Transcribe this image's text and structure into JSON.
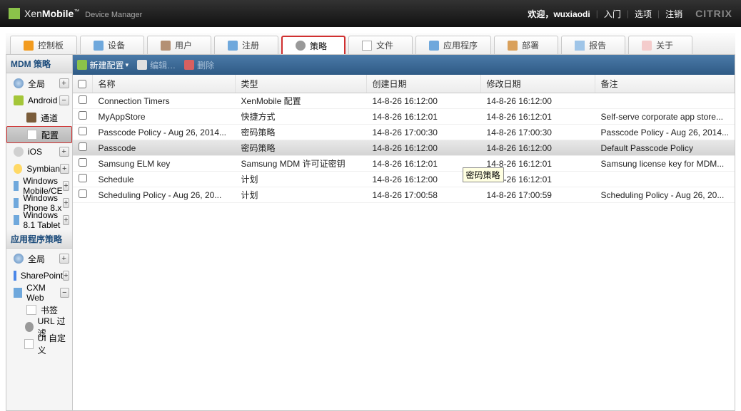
{
  "header": {
    "brand_main": "Xen",
    "brand_bold": "Mobile",
    "brand_sub": "Device Manager",
    "welcome": "欢迎，wuxiaodi",
    "links": [
      "入门",
      "选项",
      "注销"
    ],
    "citrix": "CITRIX"
  },
  "tabs": [
    {
      "label": "控制板",
      "icon": "ico-dashboard"
    },
    {
      "label": "设备",
      "icon": "ico-device"
    },
    {
      "label": "用户",
      "icon": "ico-user"
    },
    {
      "label": "注册",
      "icon": "ico-reg"
    },
    {
      "label": "策略",
      "icon": "ico-policy",
      "active": true
    },
    {
      "label": "文件",
      "icon": "ico-file"
    },
    {
      "label": "应用程序",
      "icon": "ico-app"
    },
    {
      "label": "部署",
      "icon": "ico-deploy"
    },
    {
      "label": "报告",
      "icon": "ico-report"
    },
    {
      "label": "关于",
      "icon": "ico-about"
    }
  ],
  "side": {
    "panel1": "MDM 策略",
    "panel2": "应用程序策略",
    "tree1": [
      {
        "label": "全局",
        "icon": "t-globe",
        "btn": "+",
        "pad": 0
      },
      {
        "label": "Android",
        "icon": "t-android",
        "btn": "−",
        "pad": 0
      },
      {
        "label": "通道",
        "icon": "t-channel",
        "pad": 1
      },
      {
        "label": "配置",
        "icon": "t-config",
        "pad": 1,
        "selected": true,
        "hl": true
      },
      {
        "label": "iOS",
        "icon": "t-ios",
        "btn": "+",
        "pad": 0
      },
      {
        "label": "Symbian",
        "icon": "t-symbian",
        "btn": "+",
        "pad": 0
      },
      {
        "label": "Windows Mobile/CE",
        "icon": "t-wm",
        "btn": "+",
        "pad": 0
      },
      {
        "label": "Windows Phone 8.x",
        "icon": "t-wm",
        "btn": "+",
        "pad": 0
      },
      {
        "label": "Windows 8.1 Tablet",
        "icon": "t-wm",
        "btn": "+",
        "pad": 0
      }
    ],
    "tree2": [
      {
        "label": "全局",
        "icon": "t-globe",
        "btn": "+",
        "pad": 0
      },
      {
        "label": "SharePoint",
        "icon": "t-sp",
        "btn": "+",
        "pad": 0
      },
      {
        "label": "CXM Web",
        "icon": "t-cxm",
        "btn": "−",
        "pad": 0
      },
      {
        "label": "书签",
        "icon": "t-config",
        "pad": 1
      },
      {
        "label": "URL 过滤",
        "icon": "t-filter",
        "pad": 1
      },
      {
        "label": "UI 自定义",
        "icon": "t-config",
        "pad": 1
      }
    ]
  },
  "toolbar": {
    "new": "新建配置",
    "edit": "编辑…",
    "del": "删除"
  },
  "tooltip": "密码策略",
  "table": {
    "headers": [
      "名称",
      "类型",
      "创建日期",
      "修改日期",
      "备注"
    ],
    "rows": [
      {
        "name": "Connection Timers",
        "type": "XenMobile 配置",
        "created": "14-8-26 16:12:00",
        "modified": "14-8-26 16:12:00",
        "note": ""
      },
      {
        "name": "MyAppStore",
        "type": "快捷方式",
        "created": "14-8-26 16:12:01",
        "modified": "14-8-26 16:12:01",
        "note": "Self-serve corporate app store..."
      },
      {
        "name": "Passcode Policy - Aug 26, 2014...",
        "type": "密码策略",
        "created": "14-8-26 17:00:30",
        "modified": "14-8-26 17:00:30",
        "note": "Passcode Policy - Aug 26, 2014..."
      },
      {
        "name": "Passcode",
        "type": "密码策略",
        "created": "14-8-26 16:12:00",
        "modified": "14-8-26 16:12:00",
        "note": "Default Passcode Policy",
        "sel": true
      },
      {
        "name": "Samsung ELM key",
        "type": "Samsung MDM 许可证密钥",
        "created": "14-8-26 16:12:01",
        "modified": "14-8-26 16:12:01",
        "note": "Samsung license key for MDM...",
        "tooltip": true
      },
      {
        "name": "Schedule",
        "type": "计划",
        "created": "14-8-26 16:12:00",
        "modified": "14-8-26 16:12:01",
        "note": ""
      },
      {
        "name": "Scheduling Policy - Aug 26, 20...",
        "type": "计划",
        "created": "14-8-26 17:00:58",
        "modified": "14-8-26 17:00:59",
        "note": "Scheduling Policy - Aug 26, 20..."
      }
    ]
  }
}
